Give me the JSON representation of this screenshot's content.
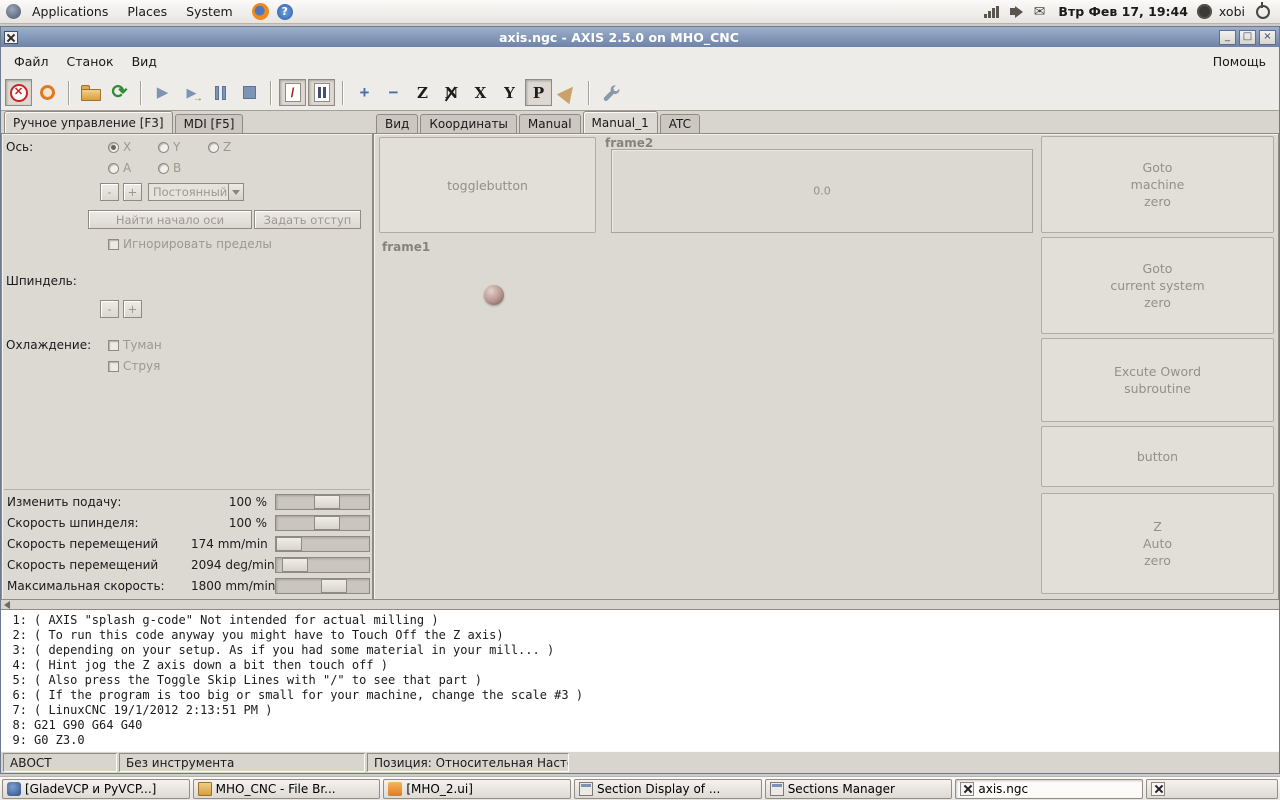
{
  "top_panel": {
    "menus": [
      "Applications",
      "Places",
      "System"
    ],
    "help_glyph": "?",
    "clock": "Втр Фев 17, 19:44",
    "username": "xobi"
  },
  "window": {
    "title": "axis.ngc - AXIS 2.5.0 on MHO_CNC",
    "buttons": {
      "minimize": "_",
      "maximize": "□",
      "close": "×"
    }
  },
  "menubar": {
    "file": "Файл",
    "machine": "Станок",
    "view": "Вид",
    "help": "Помощь"
  },
  "toolbar": {
    "estop": "✕",
    "reload": "⟳",
    "run": "▶",
    "step": "▶",
    "step_arrow": "→",
    "stop": "■",
    "skip_lines": "/",
    "zoom_in": "+",
    "zoom_out": "−",
    "view_top": "Z",
    "view_rotated": "N",
    "view_side": "X",
    "view_front": "Y",
    "view_perspective": "P"
  },
  "left_tabs": {
    "manual": "Ручное управление [F3]",
    "mdi": "MDI [F5]"
  },
  "manual": {
    "axis_label": "Ось:",
    "axis_x": "X",
    "axis_y": "Y",
    "axis_z": "Z",
    "axis_a": "A",
    "axis_b": "B",
    "jog_minus": "-",
    "jog_plus": "+",
    "jog_mode": "Постоянный",
    "home_button": "Найти начало оси",
    "offset_button": "Задать отступ",
    "override_limits": "Игнорировать пределы",
    "spindle_label": "Шпиндель:",
    "spindle_minus": "-",
    "spindle_plus": "+",
    "coolant_label": "Охлаждение:",
    "mist": "Туман",
    "flood": "Струя"
  },
  "overrides": {
    "rows": [
      {
        "label": "Изменить подачу:",
        "value": "100 %",
        "pct": 55
      },
      {
        "label": "Скорость шпинделя:",
        "value": "100 %",
        "pct": 55
      },
      {
        "label": "Скорость перемещений",
        "value": "174 mm/min",
        "pct": 14
      },
      {
        "label": "Скорость перемещений",
        "value": "2094 deg/min",
        "pct": 20
      },
      {
        "label": "Максимальная скорость:",
        "value": "1800 mm/min",
        "pct": 62
      }
    ]
  },
  "right_tabs": [
    "Вид",
    "Координаты",
    "Manual",
    "Manual_1",
    "ATC"
  ],
  "manual1": {
    "togglebutton": "togglebutton",
    "frame2_label": "frame2",
    "frame2_value": "0.0",
    "frame1_label": "frame1",
    "buttons": [
      "Goto\nmachine\nzero",
      "Goto\ncurrent system\nzero",
      "Excute Oword\nsubroutine",
      "button",
      "Z\nAuto\nzero"
    ]
  },
  "gcode": {
    "lines": [
      {
        "num": "1:",
        "text": "( AXIS \"splash g-code\" Not intended for actual milling )"
      },
      {
        "num": "2:",
        "text": "( To run this code anyway you might have to Touch Off the Z axis)"
      },
      {
        "num": "3:",
        "text": "( depending on your setup. As if you had some material in your mill... )"
      },
      {
        "num": "4:",
        "text": "( Hint jog the Z axis down a bit then touch off )"
      },
      {
        "num": "5:",
        "text": "( Also press the Toggle Skip Lines with \"/\" to see that part )"
      },
      {
        "num": "6:",
        "text": "( If the program is too big or small for your machine, change the scale #3 )"
      },
      {
        "num": "7:",
        "text": "( LinuxCNC 19/1/2012 2:13:51 PM )"
      },
      {
        "num": "8:",
        "text": "G21 G90 G64 G40"
      },
      {
        "num": "9:",
        "text": "G0 Z3.0"
      }
    ]
  },
  "statusbar": {
    "machine_state": "АВОСТ",
    "tool": "Без инструмента",
    "position": "Позиция: Относительная Насто:"
  },
  "taskbar": {
    "buttons": [
      {
        "label": "[GladeVCP и PyVCP...]"
      },
      {
        "label": "MHO_CNC - File Br..."
      },
      {
        "label": "[MHO_2.ui]"
      },
      {
        "label": "Section Display of ..."
      },
      {
        "label": "Sections Manager"
      },
      {
        "label": "axis.ngc"
      },
      {
        "label": ""
      }
    ]
  }
}
